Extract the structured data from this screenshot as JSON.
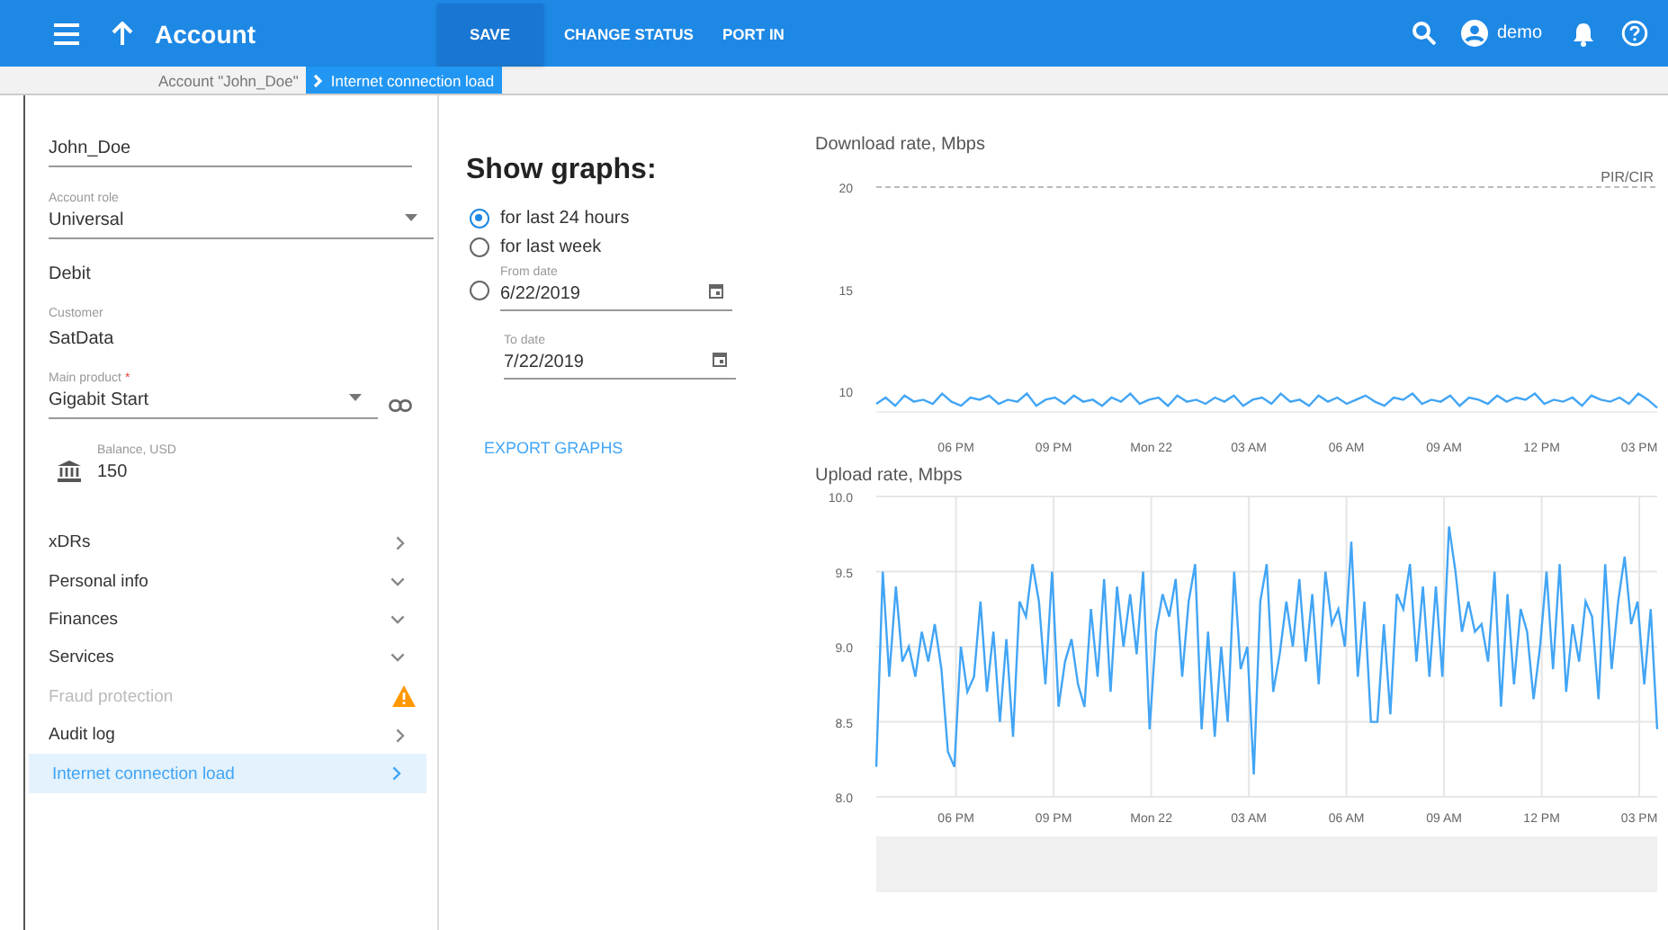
{
  "topbar": {
    "title": "Account",
    "actions": [
      {
        "label": "SAVE",
        "primary": true
      },
      {
        "label": "CHANGE STATUS",
        "primary": false
      },
      {
        "label": "PORT IN",
        "primary": false
      }
    ],
    "user": "demo"
  },
  "breadcrumb": [
    {
      "label": "Account \"John_Doe\"",
      "selected": false
    },
    {
      "label": "Internet connection load",
      "selected": true
    }
  ],
  "account": {
    "name": "John_Doe",
    "fields": [
      {
        "kind": "select",
        "label": "Account role",
        "value": "Universal"
      },
      {
        "kind": "plain",
        "value": "Debit"
      },
      {
        "kind": "plain",
        "label": "Customer",
        "value": "SatData"
      },
      {
        "kind": "select",
        "label": "Main product",
        "required_mark": "*",
        "value": "Gigabit Start",
        "link": true
      },
      {
        "kind": "balance",
        "label": "Balance, USD",
        "value": "150"
      }
    ]
  },
  "nav": [
    {
      "label": "xDRs",
      "kind": "link",
      "disabled": false,
      "selected": false
    },
    {
      "label": "Personal info",
      "kind": "expandable",
      "disabled": false,
      "selected": false
    },
    {
      "label": "Finances",
      "kind": "expandable",
      "disabled": false,
      "selected": false
    },
    {
      "label": "Services",
      "kind": "expandable",
      "disabled": false,
      "selected": false
    },
    {
      "label": "Fraud protection",
      "kind": "alert",
      "disabled": true,
      "selected": false
    },
    {
      "label": "Audit log",
      "kind": "link",
      "disabled": false,
      "selected": false
    },
    {
      "label": "Internet connection load",
      "kind": "link",
      "disabled": false,
      "selected": true
    }
  ],
  "graphs": {
    "title": "Show graphs:",
    "options": [
      {
        "kind": "radio",
        "label": "for last 24 hours",
        "selected": true
      },
      {
        "kind": "radio",
        "label": "for last week",
        "selected": false
      },
      {
        "kind": "date",
        "label": "From date",
        "value": "6/22/2019",
        "selected": false
      }
    ],
    "to_date": {
      "label": "To date",
      "value": "7/22/2019"
    },
    "export": "EXPORT GRAPHS"
  },
  "charts": [
    {
      "navigator": false,
      "time_labels": [
        "06 PM",
        "09 PM",
        "Mon 22",
        "03 AM",
        "06 AM",
        "09 AM",
        "12 PM",
        "03 PM"
      ],
      "chart_data": {
        "type": "line",
        "title": "Download rate, Mbps",
        "grid": false,
        "ylim": [
          9,
          20
        ],
        "yticks": [
          10,
          15,
          20
        ],
        "ref_lines": [
          {
            "axis": "y",
            "value": 20,
            "label": "PIR/CIR"
          }
        ],
        "series": [
          {
            "color": "#42a5f5",
            "values": [
              9.4,
              9.7,
              9.3,
              9.8,
              9.5,
              9.6,
              9.4,
              9.9,
              9.5,
              9.3,
              9.7,
              9.6,
              9.8,
              9.4,
              9.6,
              9.5,
              9.9,
              9.3,
              9.6,
              9.7,
              9.4,
              9.8,
              9.5,
              9.6,
              9.3,
              9.7,
              9.5,
              9.9,
              9.4,
              9.6,
              9.7,
              9.3,
              9.8,
              9.5,
              9.6,
              9.4,
              9.7,
              9.5,
              9.8,
              9.3,
              9.6,
              9.7,
              9.4,
              9.9,
              9.5,
              9.6,
              9.3,
              9.8,
              9.5,
              9.7,
              9.4,
              9.6,
              9.8,
              9.5,
              9.3,
              9.7,
              9.6,
              9.9,
              9.4,
              9.6,
              9.5,
              9.8,
              9.3,
              9.7,
              9.6,
              9.4,
              9.8,
              9.5,
              9.7,
              9.6,
              9.9,
              9.4,
              9.6,
              9.5,
              9.7,
              9.3,
              9.8,
              9.6,
              9.5,
              9.7,
              9.4,
              9.9,
              9.6,
              9.2
            ]
          }
        ]
      }
    },
    {
      "navigator": true,
      "time_labels": [
        "06 PM",
        "09 PM",
        "Mon 22",
        "03 AM",
        "06 AM",
        "09 AM",
        "12 PM",
        "03 PM"
      ],
      "chart_data": {
        "type": "line",
        "title": "Upload rate, Mbps",
        "grid": true,
        "ylim": [
          8,
          10
        ],
        "yticks": [
          {
            "value": 8,
            "label": "8.0"
          },
          {
            "value": 8.5,
            "label": "8.5"
          },
          {
            "value": 9,
            "label": "9.0"
          },
          {
            "value": 9.5,
            "label": "9.5"
          },
          {
            "value": 10,
            "label": "10.0"
          }
        ],
        "series": [
          {
            "color": "#42a5f5",
            "values": [
              8.2,
              9.5,
              8.8,
              9.4,
              8.9,
              9.0,
              8.8,
              9.1,
              8.9,
              9.15,
              8.85,
              8.3,
              8.2,
              9.0,
              8.7,
              8.8,
              9.3,
              8.7,
              9.1,
              8.5,
              9.05,
              8.4,
              9.3,
              9.2,
              9.55,
              9.3,
              8.75,
              9.5,
              8.6,
              8.9,
              9.05,
              8.75,
              8.6,
              9.25,
              8.8,
              9.45,
              8.7,
              9.4,
              9.0,
              9.35,
              8.95,
              9.5,
              8.45,
              9.1,
              9.35,
              9.2,
              9.45,
              8.8,
              9.3,
              9.55,
              8.45,
              9.1,
              8.4,
              9.0,
              8.5,
              9.5,
              8.85,
              9.0,
              8.15,
              9.3,
              9.55,
              8.7,
              8.95,
              9.3,
              9.0,
              9.45,
              8.9,
              9.35,
              8.75,
              9.5,
              9.15,
              9.25,
              9.0,
              9.7,
              8.8,
              9.3,
              8.5,
              8.5,
              9.15,
              8.55,
              9.35,
              9.25,
              9.55,
              8.9,
              9.4,
              8.8,
              9.4,
              8.8,
              9.8,
              9.5,
              9.1,
              9.3,
              9.1,
              9.15,
              8.9,
              9.5,
              8.6,
              9.35,
              8.75,
              9.25,
              9.1,
              8.65,
              9.0,
              9.5,
              8.85,
              9.55,
              8.7,
              9.15,
              8.9,
              9.3,
              9.2,
              8.65,
              9.55,
              8.85,
              9.3,
              9.6,
              9.15,
              9.3,
              8.75,
              9.25,
              8.45
            ]
          }
        ]
      }
    }
  ]
}
